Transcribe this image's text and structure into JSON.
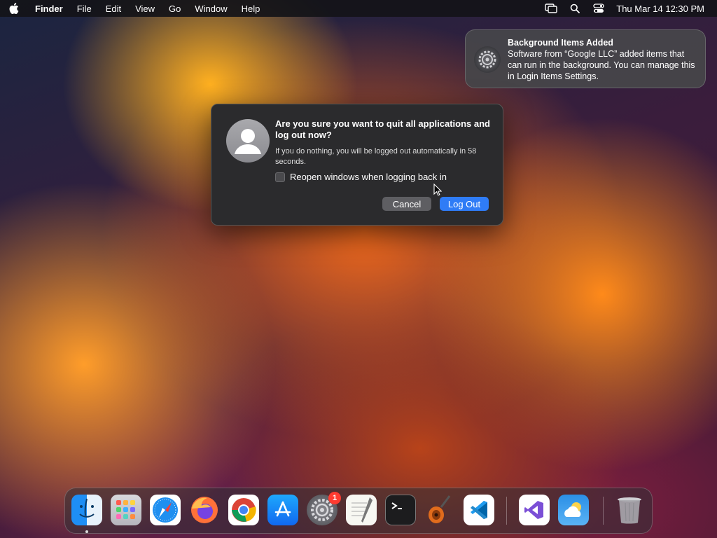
{
  "menubar": {
    "app_name": "Finder",
    "items": [
      "File",
      "Edit",
      "View",
      "Go",
      "Window",
      "Help"
    ],
    "clock": "Thu Mar 14  12:30 PM",
    "status_icons": [
      "screen-mirroring-icon",
      "search-icon",
      "control-center-icon"
    ]
  },
  "notification": {
    "title": "Background Items Added",
    "body": "Software from “Google LLC” added items that can run in the background. You can manage this in Login Items Settings.",
    "icon": "settings-gear-icon"
  },
  "dialog": {
    "title": "Are you sure you want to quit all applications and log out now?",
    "message": "If you do nothing, you will be logged out automatically in 58 seconds.",
    "checkbox_label": "Reopen windows when logging back in",
    "checkbox_checked": false,
    "cancel_label": "Cancel",
    "logout_label": "Log Out",
    "accent_color": "#2f7cf6"
  },
  "dock": {
    "apps": [
      {
        "name": "Finder",
        "icon": "finder-icon"
      },
      {
        "name": "Launchpad",
        "icon": "launchpad-icon"
      },
      {
        "name": "Safari",
        "icon": "safari-icon"
      },
      {
        "name": "Firefox",
        "icon": "firefox-icon"
      },
      {
        "name": "Chrome",
        "icon": "chrome-icon"
      },
      {
        "name": "App Store",
        "icon": "app-store-icon"
      },
      {
        "name": "System Settings",
        "icon": "system-settings-icon",
        "badge": "1"
      },
      {
        "name": "TextEdit",
        "icon": "textedit-icon"
      },
      {
        "name": "Terminal",
        "icon": "terminal-icon"
      },
      {
        "name": "GarageBand",
        "icon": "garageband-icon"
      },
      {
        "name": "Visual Studio Code",
        "icon": "vscode-icon"
      },
      {
        "name": "Visual Studio",
        "icon": "visual-studio-icon"
      },
      {
        "name": "Weather",
        "icon": "weather-icon"
      },
      {
        "name": "Trash",
        "icon": "trash-icon"
      }
    ]
  }
}
